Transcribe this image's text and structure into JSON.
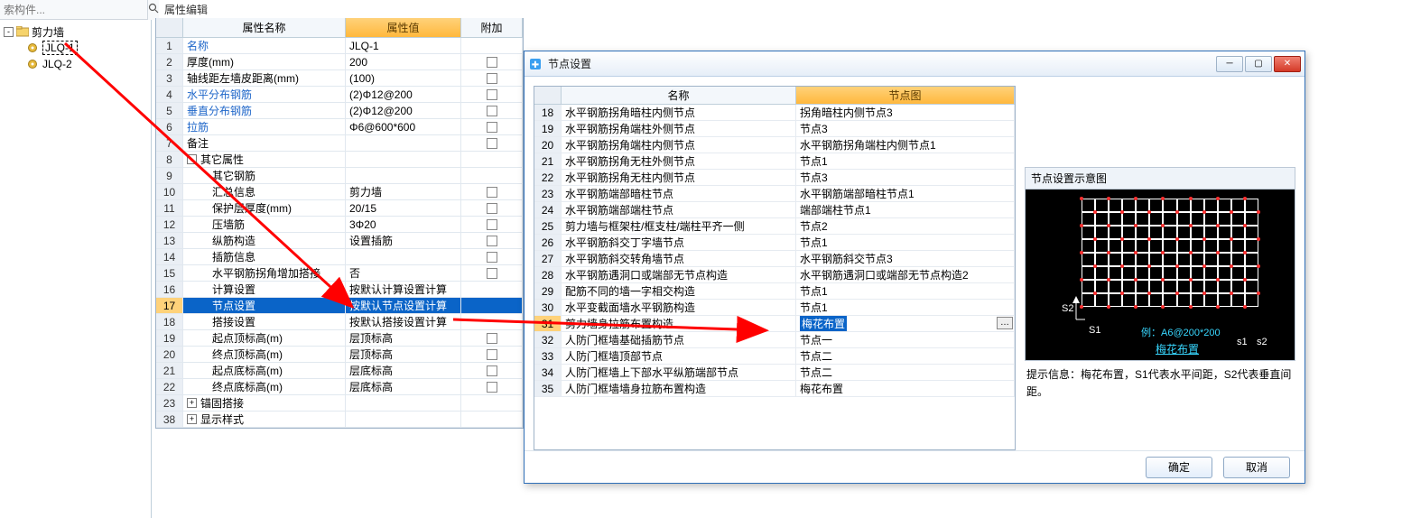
{
  "search": {
    "placeholder": "索构件..."
  },
  "tree": {
    "root": {
      "label": "剪力墙"
    },
    "children": [
      {
        "label": "JLQ-1",
        "selected": true
      },
      {
        "label": "JLQ-2",
        "selected": false
      }
    ]
  },
  "prop_tab": "属性编辑",
  "prop_headers": {
    "name": "属性名称",
    "value": "属性值",
    "extra": "附加"
  },
  "props": [
    {
      "row": "1",
      "name": "名称",
      "value": "JLQ-1",
      "link": true,
      "extra": false
    },
    {
      "row": "2",
      "name": "厚度(mm)",
      "value": "200",
      "link": false,
      "extra": true
    },
    {
      "row": "3",
      "name": "轴线距左墙皮距离(mm)",
      "value": "(100)",
      "link": false,
      "extra": true
    },
    {
      "row": "4",
      "name": "水平分布钢筋",
      "value": "(2)Φ12@200",
      "link": true,
      "extra": true
    },
    {
      "row": "5",
      "name": "垂直分布钢筋",
      "value": "(2)Φ12@200",
      "link": true,
      "extra": true
    },
    {
      "row": "6",
      "name": "拉筋",
      "value": "Φ6@600*600",
      "link": true,
      "extra": true
    },
    {
      "row": "7",
      "name": "备注",
      "value": "",
      "link": false,
      "extra": true
    },
    {
      "row": "8",
      "name": "其它属性",
      "value": "",
      "group": true,
      "expand": "-"
    },
    {
      "row": "9",
      "name": "其它钢筋",
      "value": "",
      "indent": 2
    },
    {
      "row": "10",
      "name": "汇总信息",
      "value": "剪力墙",
      "indent": 2,
      "extra": true
    },
    {
      "row": "11",
      "name": "保护层厚度(mm)",
      "value": "20/15",
      "indent": 2,
      "extra": true
    },
    {
      "row": "12",
      "name": "压墙筋",
      "value": "3Φ20",
      "indent": 2,
      "extra": true
    },
    {
      "row": "13",
      "name": "纵筋构造",
      "value": "设置插筋",
      "indent": 2,
      "extra": true
    },
    {
      "row": "14",
      "name": "插筋信息",
      "value": "",
      "indent": 2,
      "extra": true
    },
    {
      "row": "15",
      "name": "水平钢筋拐角增加搭接",
      "value": "否",
      "indent": 2,
      "extra": true
    },
    {
      "row": "16",
      "name": "计算设置",
      "value": "按默认计算设置计算",
      "indent": 2
    },
    {
      "row": "17",
      "name": "节点设置",
      "value": "按默认节点设置计算",
      "indent": 2,
      "selected": true
    },
    {
      "row": "18",
      "name": "搭接设置",
      "value": "按默认搭接设置计算",
      "indent": 2
    },
    {
      "row": "19",
      "name": "起点顶标高(m)",
      "value": "层顶标高",
      "indent": 2,
      "extra": true
    },
    {
      "row": "20",
      "name": "终点顶标高(m)",
      "value": "层顶标高",
      "indent": 2,
      "extra": true
    },
    {
      "row": "21",
      "name": "起点底标高(m)",
      "value": "层底标高",
      "indent": 2,
      "extra": true
    },
    {
      "row": "22",
      "name": "终点底标高(m)",
      "value": "层底标高",
      "indent": 2,
      "extra": true
    },
    {
      "row": "23",
      "name": "锚固搭接",
      "value": "",
      "group": true,
      "expand": "+"
    },
    {
      "row": "38",
      "name": "显示样式",
      "value": "",
      "group": true,
      "expand": "+"
    }
  ],
  "dialog": {
    "title": "节点设置",
    "headers": {
      "name": "名称",
      "img": "节点图"
    },
    "rows": [
      {
        "row": "18",
        "name": "水平钢筋拐角暗柱内侧节点",
        "img": "拐角暗柱内侧节点3"
      },
      {
        "row": "19",
        "name": "水平钢筋拐角端柱外侧节点",
        "img": "节点3"
      },
      {
        "row": "20",
        "name": "水平钢筋拐角端柱内侧节点",
        "img": "水平钢筋拐角端柱内侧节点1"
      },
      {
        "row": "21",
        "name": "水平钢筋拐角无柱外侧节点",
        "img": "节点1"
      },
      {
        "row": "22",
        "name": "水平钢筋拐角无柱内侧节点",
        "img": "节点3"
      },
      {
        "row": "23",
        "name": "水平钢筋端部暗柱节点",
        "img": "水平钢筋端部暗柱节点1"
      },
      {
        "row": "24",
        "name": "水平钢筋端部端柱节点",
        "img": "端部端柱节点1"
      },
      {
        "row": "25",
        "name": "剪力墙与框架柱/框支柱/端柱平齐一侧",
        "img": "节点2"
      },
      {
        "row": "26",
        "name": "水平钢筋斜交丁字墙节点",
        "img": "节点1"
      },
      {
        "row": "27",
        "name": "水平钢筋斜交转角墙节点",
        "img": "水平钢筋斜交节点3"
      },
      {
        "row": "28",
        "name": "水平钢筋遇洞口或端部无节点构造",
        "img": "水平钢筋遇洞口或端部无节点构造2"
      },
      {
        "row": "29",
        "name": "配筋不同的墙一字相交构造",
        "img": "节点1"
      },
      {
        "row": "30",
        "name": "水平变截面墙水平钢筋构造",
        "img": "节点1"
      },
      {
        "row": "31",
        "name": "剪力墙身拉筋布置构造",
        "img": "梅花布置",
        "selected": true
      },
      {
        "row": "32",
        "name": "人防门框墙基础插筋节点",
        "img": "节点一"
      },
      {
        "row": "33",
        "name": "人防门框墙顶部节点",
        "img": "节点二"
      },
      {
        "row": "34",
        "name": "人防门框墙上下部水平纵筋端部节点",
        "img": "节点二"
      },
      {
        "row": "35",
        "name": "人防门框墙墙身拉筋布置构造",
        "img": "梅花布置"
      }
    ],
    "preview_title": "节点设置示意图",
    "preview_link": "梅花布置",
    "preview_example": "例：A6@200*200",
    "preview_s1": "S1",
    "preview_s2": "S2",
    "preview_s1b": "s1",
    "preview_s2b": "s2",
    "hint_label": "提示信息：",
    "hint_text": "梅花布置，S1代表水平间距，S2代表垂直间距。",
    "ok": "确定",
    "cancel": "取消"
  }
}
